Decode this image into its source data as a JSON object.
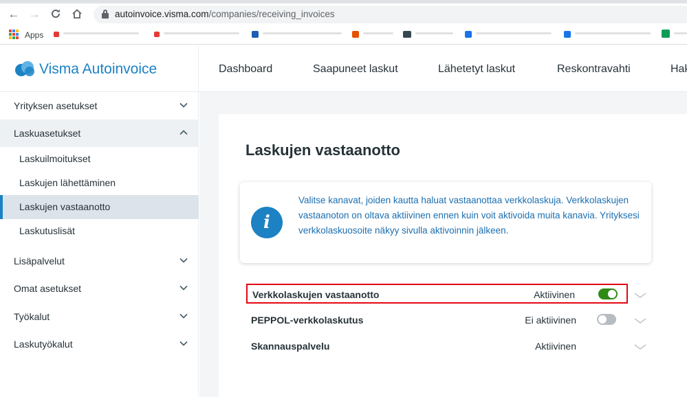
{
  "browser": {
    "url_host": "autoinvoice.visma.com",
    "url_path": "/companies/receiving_invoices",
    "bookmarks_apps_label": "Apps"
  },
  "app": {
    "logo_text": "Visma Autoinvoice",
    "nav": [
      "Dashboard",
      "Saapuneet laskut",
      "Lähetetyt laskut",
      "Reskontravahti",
      "Hak"
    ]
  },
  "sidebar": {
    "items": [
      {
        "label": "Yrityksen asetukset"
      },
      {
        "label": "Laskuasetukset"
      },
      {
        "label": "Lisäpalvelut"
      },
      {
        "label": "Omat asetukset"
      },
      {
        "label": "Työkalut"
      },
      {
        "label": "Laskutyökalut"
      }
    ],
    "subitems": [
      {
        "label": "Laskuilmoitukset"
      },
      {
        "label": "Laskujen lähettäminen"
      },
      {
        "label": "Laskujen vastaanotto"
      },
      {
        "label": "Laskutuslisät"
      }
    ]
  },
  "main": {
    "title": "Laskujen vastaanotto",
    "info_text": "Valitse kanavat, joiden kautta haluat vastaanottaa verkkolaskuja. Verkkolaskujen vastaanoton on oltava aktiivinen ennen kuin voit aktivoida muita kanavia. Yrityksesi verkkolaskuosoite näkyy sivulla aktivoinnin jälkeen.",
    "channels": [
      {
        "name": "Verkkolaskujen vastaanotto",
        "status": "Aktiivinen",
        "toggle_on": true
      },
      {
        "name": "PEPPOL-verkkolaskutus",
        "status": "Ei aktiivinen",
        "toggle_on": false
      },
      {
        "name": "Skannauspalvelu",
        "status": "Aktiivinen"
      }
    ]
  },
  "colors": {
    "brand_blue": "#1c82c4",
    "toggle_on": "#2e8b16",
    "toggle_off": "#b7bcc1",
    "highlight_red": "#e30613"
  }
}
